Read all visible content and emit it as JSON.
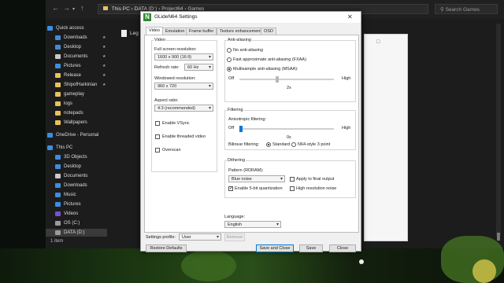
{
  "explorer": {
    "breadcrumb": [
      "This PC",
      "DATA (D:)",
      "Project64",
      "Games"
    ],
    "search_placeholder": "Search Games",
    "nav": [
      {
        "label": "Quick access",
        "color": "#3c8de0",
        "pinned": false
      },
      {
        "label": "Downloads",
        "color": "#3c8de0",
        "pinned": true
      },
      {
        "label": "Desktop",
        "color": "#3c8de0",
        "pinned": true
      },
      {
        "label": "Documents",
        "color": "#c9c9c9",
        "pinned": true
      },
      {
        "label": "Pictures",
        "color": "#3c8de0",
        "pinned": true
      },
      {
        "label": "Release",
        "color": "#e8c15a",
        "pinned": true
      },
      {
        "label": "ShipofHarkinian",
        "color": "#e8c15a",
        "pinned": true
      },
      {
        "label": "gameplay",
        "color": "#e8c15a",
        "pinned": false
      },
      {
        "label": "logs",
        "color": "#e8c15a",
        "pinned": false
      },
      {
        "label": "notepads",
        "color": "#e8c15a",
        "pinned": false
      },
      {
        "label": "Wallpapers",
        "color": "#e8c15a",
        "pinned": false
      },
      {
        "label": "OneDrive - Personal",
        "color": "#3c8de0",
        "pinned": false
      },
      {
        "label": "This PC",
        "color": "#3c8de0",
        "pinned": false
      },
      {
        "label": "3D Objects",
        "color": "#3c8de0",
        "pinned": false
      },
      {
        "label": "Desktop",
        "color": "#3c8de0",
        "pinned": false
      },
      {
        "label": "Documents",
        "color": "#c9c9c9",
        "pinned": false
      },
      {
        "label": "Downloads",
        "color": "#3c8de0",
        "pinned": false
      },
      {
        "label": "Music",
        "color": "#3c8de0",
        "pinned": false
      },
      {
        "label": "Pictures",
        "color": "#3c8de0",
        "pinned": false
      },
      {
        "label": "Videos",
        "color": "#7a4fd0",
        "pinned": false
      },
      {
        "label": "OS (C:)",
        "color": "#9a9a9a",
        "pinned": false
      },
      {
        "label": "DATA (D:)",
        "color": "#9a9a9a",
        "pinned": false
      }
    ],
    "file_name": "Leg",
    "status": "1 item"
  },
  "dialog": {
    "title": "GLideN64 Settings",
    "logo_letter": "N",
    "tabs": [
      "Video",
      "Emulation",
      "Frame buffer",
      "Texture enhancement",
      "OSD"
    ],
    "active_tab": "Video",
    "video": {
      "group_label": "Video",
      "fullscreen_label": "Full screen resolution:",
      "fullscreen_value": "1600 x 900 (16:9)",
      "refresh_label": "Refresh rate:",
      "refresh_value": "60 Hz",
      "windowed_label": "Windowed resolution:",
      "windowed_value": "960 x 720",
      "aspect_label": "Aspect ratio:",
      "aspect_value": "4:3 (recommended)",
      "vsync_label": "Enable VSync",
      "vsync_checked": false,
      "threaded_label": "Enable threaded video",
      "threaded_checked": false,
      "overscan_label": "Overscan",
      "overscan_checked": false
    },
    "antialiasing": {
      "group_label": "Anti-aliasing",
      "options": [
        "No anti-aliasing",
        "Fast approximate anti-aliasing (FXAA)",
        "Multisample anti-aliasing (MSAA):"
      ],
      "selected_index": 2,
      "slider_min": "Off",
      "slider_max": "High",
      "slider_value": "2x",
      "slider_level": 0.4
    },
    "filtering": {
      "group_label": "Filtering",
      "anisotropic_label": "Anisotropic filtering:",
      "slider_min": "Off",
      "slider_max": "High",
      "slider_value": "0x",
      "slider_level": 0.0,
      "bilinear_label": "Bilinear filtering:",
      "bilinear_options": [
        "Standard",
        "N64-style 3 point"
      ],
      "bilinear_selected": 0
    },
    "dithering": {
      "group_label": "Dithering",
      "pattern_label": "Pattern (RDRAM):",
      "pattern_value": "Blue noise",
      "quantization_label": "Enable 5-bit quantization",
      "quantization_checked": true,
      "apply_final_label": "Apply to final output",
      "apply_final_checked": false,
      "high_res_noise_label": "High resolution noise",
      "high_res_noise_checked": false
    },
    "language_label": "Language:",
    "language_value": "English",
    "profile_label": "Settings profile:",
    "profile_value": "User",
    "remove_label": "Remove",
    "restore_label": "Restore Defaults",
    "save_close_label": "Save and Close",
    "save_label": "Save",
    "close_label": "Close"
  }
}
